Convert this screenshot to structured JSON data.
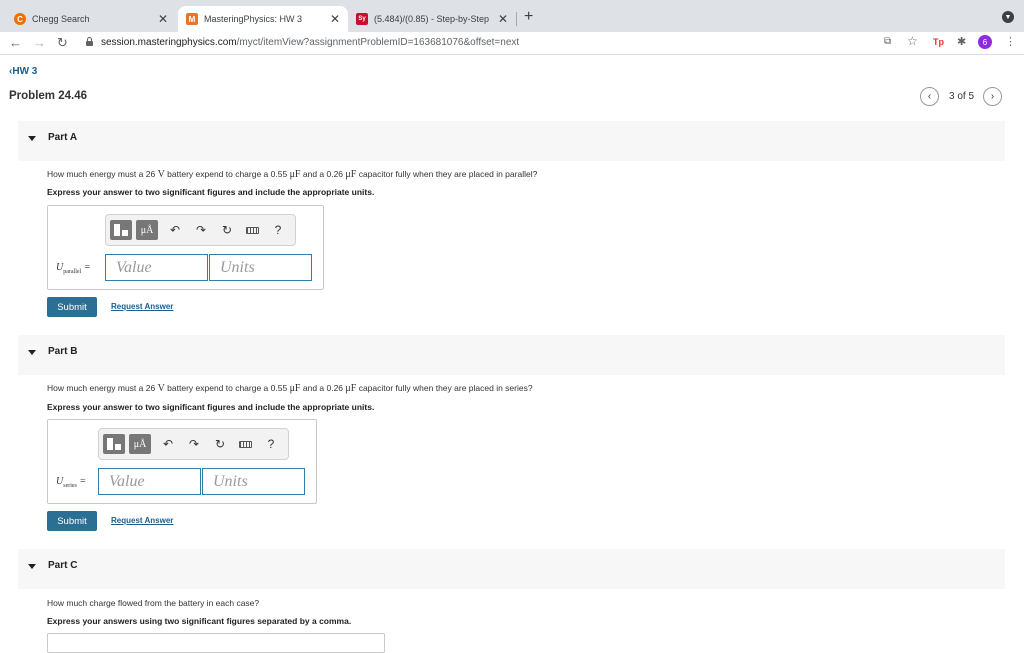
{
  "browser": {
    "tabs": [
      {
        "title": "Chegg Search",
        "favicon": "C",
        "favicon_color": "#eb7100"
      },
      {
        "title": "MasteringPhysics: HW 3",
        "favicon": "M",
        "favicon_color": "#e8752d"
      },
      {
        "title": "(5.484)/(0.85) - Step-by-Step",
        "favicon": "Sy",
        "favicon_color": "#c8102e"
      }
    ],
    "url_host": "session.masteringphysics.com",
    "url_path": "/myct/itemView?assignmentProblemID=163681076&offset=next",
    "profile_initial": "6",
    "ext_tp": "Tp"
  },
  "page": {
    "back_link": "HW 3",
    "problem_title": "Problem 24.46",
    "pager": "3 of 5"
  },
  "parts": [
    {
      "label": "Part A",
      "question_pre": "How much energy must a 26 ",
      "q_v": "V",
      "question_mid": " battery expend to charge a 0.55 ",
      "q_uf1": "μF",
      "question_mid2": " and a 0.26 ",
      "q_uf2": "μF",
      "question_post": " capacitor fully when they are placed in parallel?",
      "instruction": "Express your answer to two significant figures and include the appropriate units.",
      "var_main": "U",
      "var_sub": "parallel",
      "value_placeholder": "Value",
      "units_placeholder": "Units",
      "submit": "Submit",
      "request": "Request Answer"
    },
    {
      "label": "Part B",
      "question_pre": "How much energy must a 26 ",
      "q_v": "V",
      "question_mid": " battery expend to charge a 0.55 ",
      "q_uf1": "μF",
      "question_mid2": " and a 0.26 ",
      "q_uf2": "μF",
      "question_post": " capacitor fully when they are placed in series?",
      "instruction": "Express your answer to two significant figures and include the appropriate units.",
      "var_main": "U",
      "var_sub": "series",
      "value_placeholder": "Value",
      "units_placeholder": "Units",
      "submit": "Submit",
      "request": "Request Answer"
    },
    {
      "label": "Part C",
      "question": "How much charge flowed from the battery in each case?",
      "instruction": "Express your answers using two significant figures separated by a comma."
    }
  ],
  "toolbar": {
    "units_label": "μÅ",
    "help": "?"
  }
}
